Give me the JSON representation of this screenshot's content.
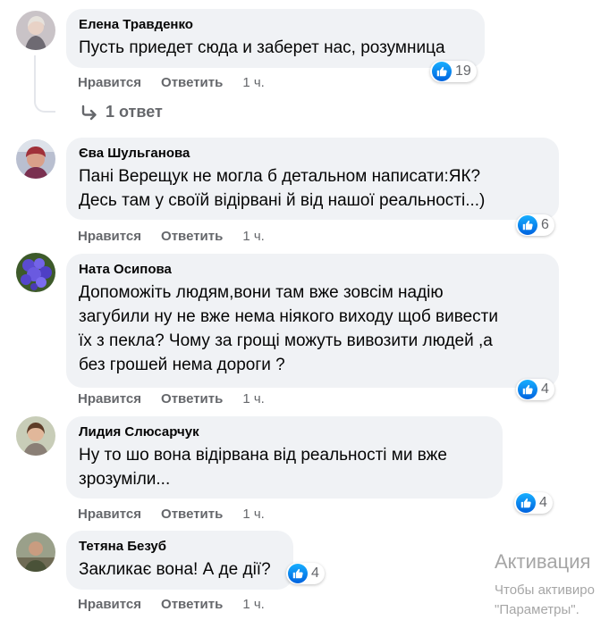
{
  "comments": [
    {
      "author": "Елена Травденко",
      "text": "Пусть приедет сюда и заберет нас, розумница",
      "reactions": "19",
      "like_label": "Нравится",
      "reply_label": "Ответить",
      "time": "1 ч.",
      "replies_label": "1 ответ"
    },
    {
      "author": "Єва Шульганова",
      "text_lines": [
        "Пані Верещук не могла б детальном написати:ЯК?",
        "Десь там у своїй відірвані й від нашої реальності...)"
      ],
      "reactions": "6",
      "like_label": "Нравится",
      "reply_label": "Ответить",
      "time": "1 ч."
    },
    {
      "author": "Ната Осипова",
      "text_lines": [
        "Допоможіть людям,вони там вже зовсім надію",
        "загубили ну не вже нема ніякого виходу щоб вивести",
        "їх з пекла? Чому за грощі можуть вивозити людей ,а",
        "без грошей нема дороги ?"
      ],
      "reactions": "4",
      "like_label": "Нравится",
      "reply_label": "Ответить",
      "time": "1 ч."
    },
    {
      "author": "Лидия Слюсарчук",
      "text_lines": [
        "Ну то шо вона відірвана від реальності ми вже",
        "зрозуміли..."
      ],
      "reactions": "4",
      "like_label": "Нравится",
      "reply_label": "Ответить",
      "time": "1 ч."
    },
    {
      "author": "Тетяна Безуб",
      "text": "Закликає вона! А де дії?",
      "reactions": "4",
      "like_label": "Нравится",
      "reply_label": "Ответить",
      "time": "1 ч."
    }
  ],
  "watermark": {
    "title": "Активация",
    "line1": "Чтобы активиро",
    "line2": "\"Параметры\"."
  },
  "colors": {
    "bubble": "#f0f2f5",
    "like_blue": "#1877f2",
    "meta_gray": "#65676b"
  },
  "icons": [
    "like-thumb-icon",
    "reply-arrow-icon",
    "avatar-image"
  ]
}
